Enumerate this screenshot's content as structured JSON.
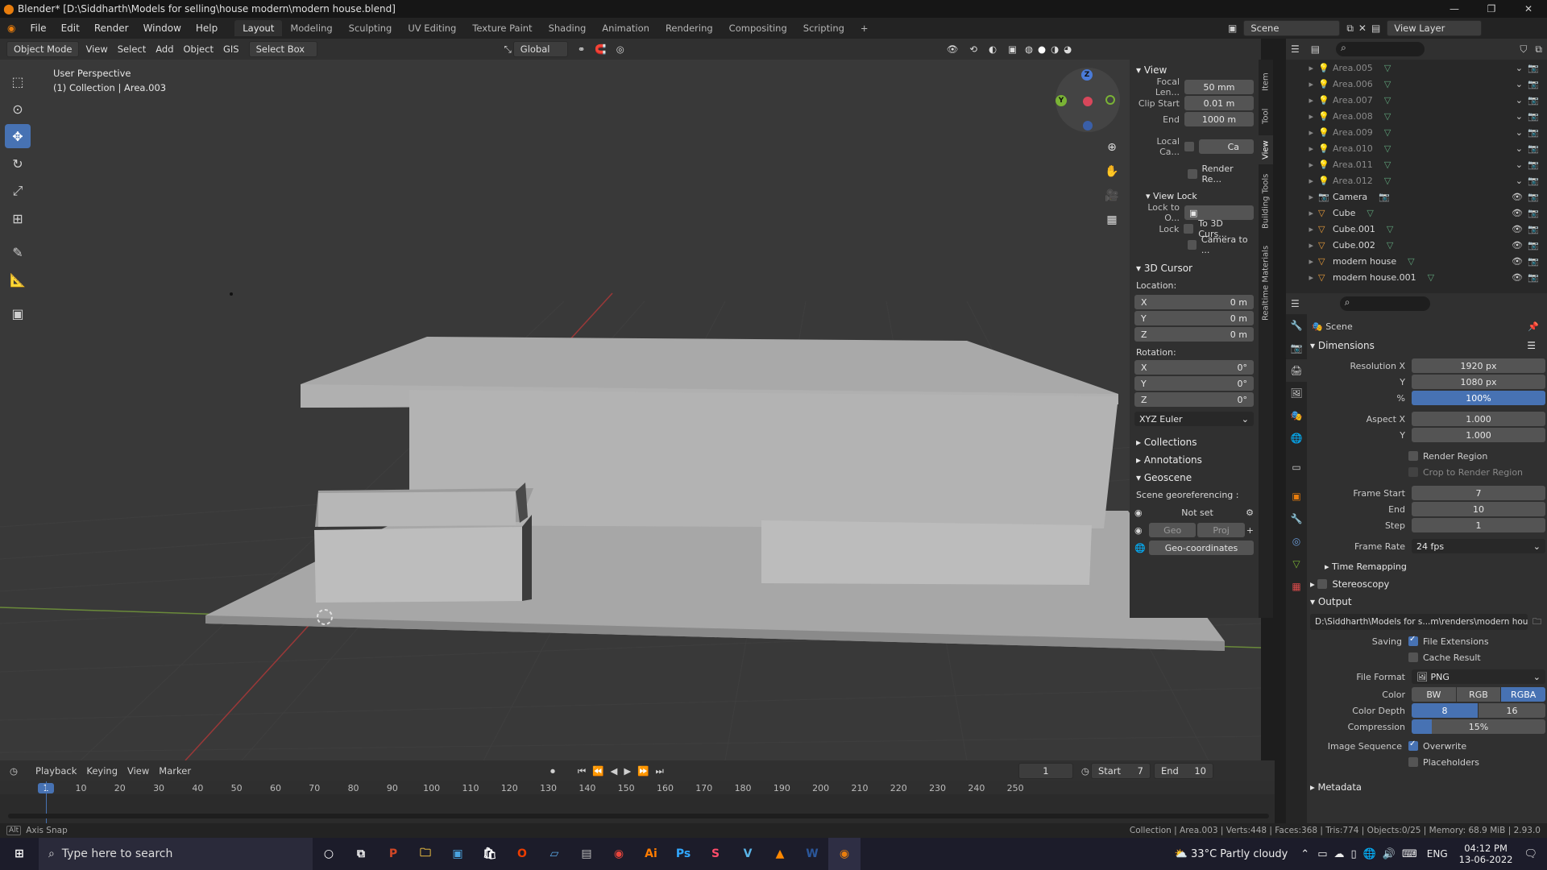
{
  "title": "Blender* [D:\\Siddharth\\Models for selling\\house modern\\modern house.blend]",
  "menu": [
    "File",
    "Edit",
    "Render",
    "Window",
    "Help"
  ],
  "workspaces": [
    "Layout",
    "Modeling",
    "Sculpting",
    "UV Editing",
    "Texture Paint",
    "Shading",
    "Animation",
    "Rendering",
    "Compositing",
    "Scripting"
  ],
  "scene_label": "Scene",
  "viewlayer_label": "View Layer",
  "header": {
    "mode": "Object Mode",
    "view": "View",
    "select": "Select",
    "add": "Add",
    "object": "Object",
    "gis": "GIS",
    "selectbox": "Select Box",
    "orientation": "Global"
  },
  "viewport": {
    "persp": "User Perspective",
    "collection": "(1) Collection | Area.003"
  },
  "npanel": {
    "view_title": "View",
    "focal_label": "Focal Len...",
    "focal": "50 mm",
    "clipstart_label": "Clip Start",
    "clipstart": "0.01 m",
    "end_label": "End",
    "end": "1000 m",
    "localcam_label": "Local Ca...",
    "localcam_value": "Ca",
    "render_label": "Render Re...",
    "viewlock_title": "View Lock",
    "lockto_label": "Lock to O...",
    "lock_label": "Lock",
    "to3d": "To 3D Curs...",
    "camerato": "Camera to ...",
    "cursor_title": "3D Cursor",
    "location": "Location:",
    "x": "X",
    "y": "Y",
    "z": "Z",
    "loc_x": "0 m",
    "loc_y": "0 m",
    "loc_z": "0 m",
    "rotation": "Rotation:",
    "rot_x": "0°",
    "rot_y": "0°",
    "rot_z": "0°",
    "euler": "XYZ Euler",
    "collections": "Collections",
    "annotations": "Annotations",
    "geoscene": "Geoscene",
    "scene_geo": "Scene georeferencing :",
    "notset": "Not set",
    "geo": "Geo",
    "proj": "Proj",
    "geocoords": "Geo-coordinates"
  },
  "sidetabs": [
    "Item",
    "Tool",
    "View",
    "Building Tools",
    "Realtime Materials"
  ],
  "outliner": [
    {
      "name": "Area.005",
      "dim": true
    },
    {
      "name": "Area.006",
      "dim": true
    },
    {
      "name": "Area.007",
      "dim": true
    },
    {
      "name": "Area.008",
      "dim": true
    },
    {
      "name": "Area.009",
      "dim": true
    },
    {
      "name": "Area.010",
      "dim": true
    },
    {
      "name": "Area.011",
      "dim": true
    },
    {
      "name": "Area.012",
      "dim": true
    },
    {
      "name": "Camera",
      "dim": false
    },
    {
      "name": "Cube",
      "dim": false
    },
    {
      "name": "Cube.001",
      "dim": false
    },
    {
      "name": "Cube.002",
      "dim": false
    },
    {
      "name": "modern house",
      "dim": false
    },
    {
      "name": "modern house.001",
      "dim": false
    }
  ],
  "props": {
    "scene": "Scene",
    "dimensions": "Dimensions",
    "resx_label": "Resolution X",
    "resx": "1920 px",
    "resy_label": "Y",
    "resy": "1080 px",
    "pct_label": "%",
    "pct": "100%",
    "aspx_label": "Aspect X",
    "aspx": "1.000",
    "aspy_label": "Y",
    "aspy": "1.000",
    "render_region": "Render Region",
    "crop": "Crop to Render Region",
    "fstart_label": "Frame Start",
    "fstart": "7",
    "fend_label": "End",
    "fend": "10",
    "step_label": "Step",
    "step": "1",
    "frate_label": "Frame Rate",
    "frate": "24 fps",
    "time_remap": "Time Remapping",
    "stereo": "Stereoscopy",
    "output": "Output",
    "path": "D:\\Siddharth\\Models for s...m\\renders\\modern house",
    "saving_label": "Saving",
    "file_ext": "File Extensions",
    "cache": "Cache Result",
    "format_label": "File Format",
    "format": "PNG",
    "color_label": "Color",
    "bw": "BW",
    "rgb": "RGB",
    "rgba": "RGBA",
    "depth_label": "Color Depth",
    "d8": "8",
    "d16": "16",
    "comp_label": "Compression",
    "comp": "15%",
    "imgseq_label": "Image Sequence",
    "overwrite": "Overwrite",
    "placeholders": "Placeholders",
    "metadata": "Metadata"
  },
  "timeline": {
    "playback": "Playback",
    "keying": "Keying",
    "view": "View",
    "marker": "Marker",
    "current": "1",
    "start_label": "Start",
    "start": "7",
    "end_label": "End",
    "end": "10",
    "ticks": [
      "1",
      "10",
      "20",
      "30",
      "40",
      "50",
      "60",
      "70",
      "80",
      "90",
      "100",
      "110",
      "120",
      "130",
      "140",
      "150",
      "160",
      "170",
      "180",
      "190",
      "200",
      "210",
      "220",
      "230",
      "240",
      "250"
    ]
  },
  "status": {
    "left": "Axis Snap",
    "right": "Collection | Area.003 | Verts:448 | Faces:368 | Tris:774 | Objects:0/25 | Memory: 68.9 MiB | 2.93.0"
  },
  "taskbar": {
    "search": "Type here to search",
    "weather": "33°C  Partly cloudy",
    "lang": "ENG",
    "time": "04:12 PM",
    "date": "13-06-2022"
  }
}
